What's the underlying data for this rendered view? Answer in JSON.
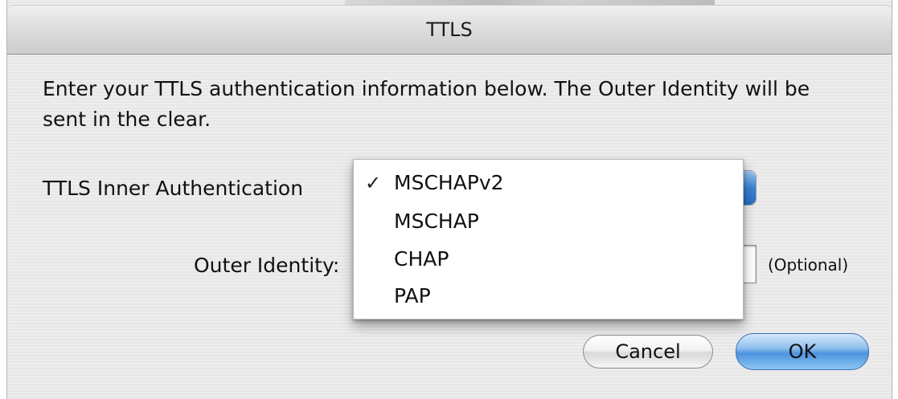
{
  "window": {
    "title": "TTLS"
  },
  "description": "Enter your TTLS authentication information below. The Outer Identity will be sent in the clear.",
  "inner_auth": {
    "label": "TTLS Inner Authentication",
    "selected": "MSCHAPv2",
    "options": [
      {
        "label": "MSCHAPv2",
        "checked": true,
        "check_glyph": "✓"
      },
      {
        "label": "MSCHAP",
        "checked": false,
        "check_glyph": ""
      },
      {
        "label": "CHAP",
        "checked": false,
        "check_glyph": ""
      },
      {
        "label": "PAP",
        "checked": false,
        "check_glyph": ""
      }
    ]
  },
  "outer_identity": {
    "label": "Outer Identity:",
    "value": "",
    "hint": "(Optional)"
  },
  "buttons": {
    "cancel": "Cancel",
    "ok": "OK"
  },
  "colors": {
    "default_button": "#4d93dd",
    "popup_arrows": "#3b82d6"
  },
  "icons": {
    "checkmark": "checkmark-icon",
    "popup_arrows": "updown-arrows-icon"
  }
}
